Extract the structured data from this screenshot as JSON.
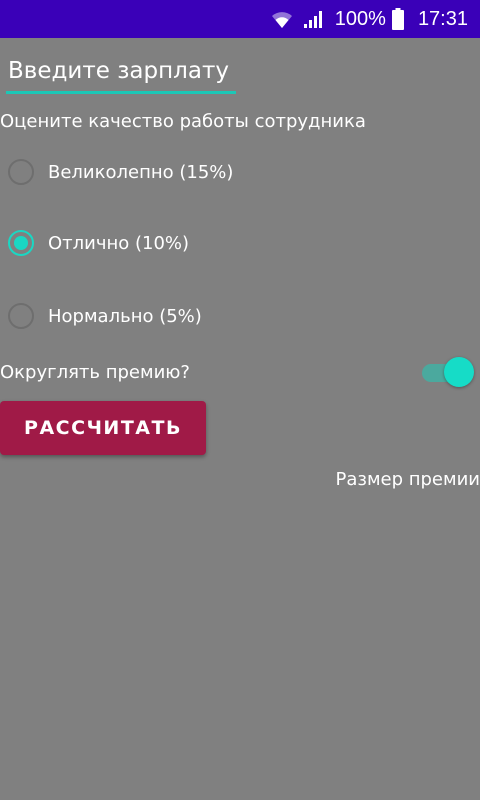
{
  "status_bar": {
    "wifi_icon": "wifi-icon",
    "signal_icon": "signal-icon",
    "battery_percent": "100%",
    "battery_icon": "battery-icon",
    "time": "17:31",
    "background_color": "#3a00b8"
  },
  "form": {
    "salary_placeholder": "Введите зарплату",
    "salary_value": "",
    "quality_label": "Оцените качество работы сотрудника",
    "options": [
      {
        "label": "Великолепно (15%)",
        "checked": false
      },
      {
        "label": "Отлично (10%)",
        "checked": true
      },
      {
        "label": "Нормально (5%)",
        "checked": false
      }
    ],
    "round_label": "Округлять премию?",
    "round_enabled": true,
    "calculate_label": "РАССЧИТАТЬ",
    "result_text": "Размер премии"
  },
  "colors": {
    "background": "#808080",
    "accent": "#1ad7c3",
    "button": "#a01a47"
  }
}
